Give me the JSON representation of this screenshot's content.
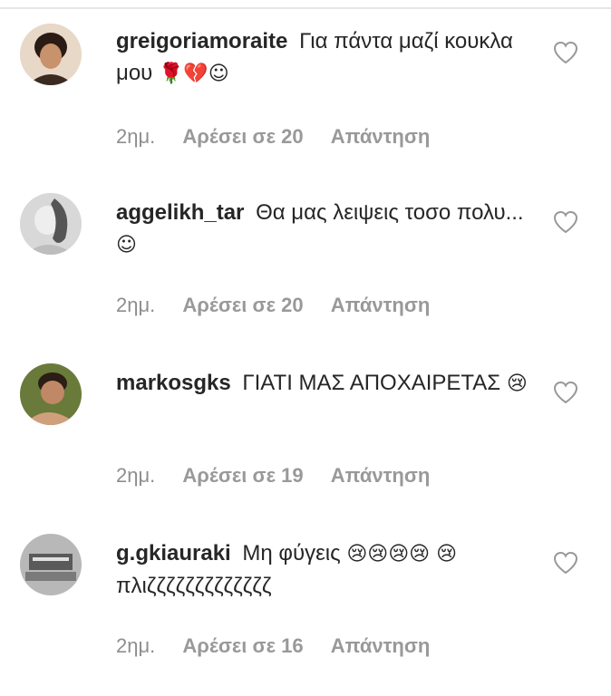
{
  "comments": [
    {
      "username": "greigoriamoraite",
      "text": "Για πάντα μαζί κουκλα μου",
      "emoji": "🌹💔☺",
      "time": "2ημ.",
      "likes": "Αρέσει σε 20",
      "reply": "Απάντηση",
      "avatar_color": "#6b4a3a"
    },
    {
      "username": "aggelikh_tar",
      "text": "Θα μας λειψεις τοσο πολυ...",
      "emoji": "☺",
      "time": "2ημ.",
      "likes": "Αρέσει σε 20",
      "reply": "Απάντηση",
      "avatar_color": "#cfcfcf"
    },
    {
      "username": "markosgks",
      "text": "ΓΙΑΤΙ ΜΑΣ ΑΠΟΧΑΙΡΕΤΑΣ",
      "emoji": "😢",
      "time": "2ημ.",
      "likes": "Αρέσει σε 19",
      "reply": "Απάντηση",
      "avatar_color": "#8a5a3c"
    },
    {
      "username": "g.gkiauraki",
      "text": "Μη φύγεις",
      "emoji": "😢😢😢😢 😢",
      "text_after": "πλιζζζζζζζζζζζζζ",
      "time": "2ημ.",
      "likes": "Αρέσει σε 16",
      "reply": "Απάντηση",
      "avatar_color": "#9a9a9a"
    }
  ],
  "colors": {
    "text": "#262626",
    "meta": "#8e8e8e",
    "heart_stroke": "#999999"
  },
  "icons": {
    "like": "heart-outline-icon"
  }
}
